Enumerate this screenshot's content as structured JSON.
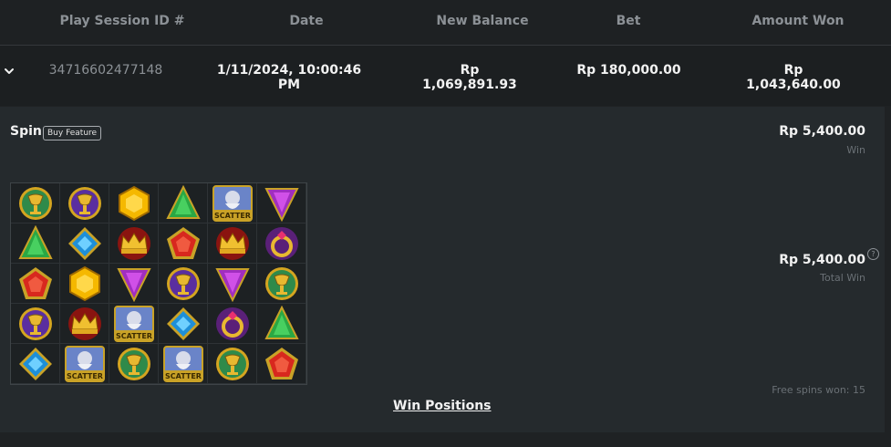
{
  "table": {
    "headers": [
      "Play Session ID #",
      "Date",
      "New Balance",
      "Bet",
      "Amount Won"
    ],
    "row": {
      "session_id": "34716602477148",
      "date": "1/11/2024, 10:00:46 PM",
      "new_balance": "Rp 1,069,891.93",
      "bet": "Rp 180,000.00",
      "amount_won": "Rp 1,043,640.00"
    }
  },
  "detail": {
    "title": "Spin",
    "badge": "Buy Feature",
    "win_amount": "Rp 5,400.00",
    "win_label": "Win",
    "total_amount": "Rp 5,400.00",
    "total_label": "Total Win",
    "help_icon": "?",
    "free_spins": "Free spins won: 15",
    "win_positions_link": "Win Positions"
  },
  "colors": {
    "background": "#1f2224",
    "panel": "#252a2d",
    "header_text": "#8c9196",
    "muted": "#6a7075"
  },
  "reels": [
    [
      "chalice-green",
      "chalice-purple",
      "gem-yellow",
      "triangle-green",
      "scatter",
      "triangle-purple"
    ],
    [
      "triangle-green",
      "diamond-blue",
      "crown",
      "pentagon-red",
      "crown",
      "ring-purple"
    ],
    [
      "pentagon-red",
      "gem-yellow",
      "triangle-purple",
      "chalice-purple",
      "triangle-purple",
      "chalice-green"
    ],
    [
      "chalice-purple",
      "crown",
      "scatter",
      "diamond-blue",
      "ring-purple",
      "triangle-green"
    ],
    [
      "diamond-blue",
      "scatter",
      "chalice-green",
      "scatter",
      "chalice-green",
      "pentagon-red"
    ]
  ],
  "scatter_text": "SCATTER"
}
